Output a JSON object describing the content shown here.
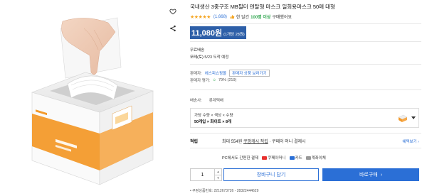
{
  "product": {
    "title": "국내생산 3중구조 MB필터 덴탈형 마스크 일회용마스크 50매 대형",
    "stars": "★★★★★",
    "review_count": "(1,668)",
    "buyers_pre": "한 달간",
    "buyers_hl": "100명 이상",
    "buyers_post": "구매했어요",
    "price": "11,080원",
    "unit_price": "(1개당 28원)",
    "shipping_label": "무료배송",
    "shipping_day": "모레(토)",
    "shipping_date": "5/23 도착 예정",
    "seller_label": "판매자:",
    "seller_name": "에스피쇼핑몰",
    "seller_more": "판매자 상품 보러가기",
    "rating_label": "판매자 평가:",
    "rating_stars": "☺",
    "rating_value": "79% (219)",
    "delivery_label": "배송사:",
    "delivery_value": "롯데택배",
    "option_line1": "가당 수량 × 색상 × 수량",
    "option_line2": "50개입 × 화이트 × 8개",
    "points_label": "적립",
    "points_text_pre": "최대 554원",
    "points_text_link": "쿠팡캐시 적립",
    "points_text_post": "· 쿠페이 머니 결제시",
    "points_benefit": "혜택보기 ›",
    "pay_prefix": "PC에서도 간편한 결제",
    "pay_methods": [
      "쿠페이머니",
      "카드",
      "계좌이체"
    ],
    "quantity": "1",
    "qty_up": "▲",
    "qty_down": "▼",
    "cart_label": "장바구니 담기",
    "buy_label": "바로구매",
    "buy_arrow": "›",
    "product_no": "• 쿠팡상품번호: 2212673726 - 28322444629"
  },
  "icons": {
    "heart": "heart-icon",
    "share": "share-icon"
  },
  "colors": {
    "accent": "#2b6fd6",
    "price_highlight": "#2d5fa8",
    "star": "#f5a623",
    "buyers_highlight": "#34a853",
    "box_orange": "#f39a2b"
  }
}
